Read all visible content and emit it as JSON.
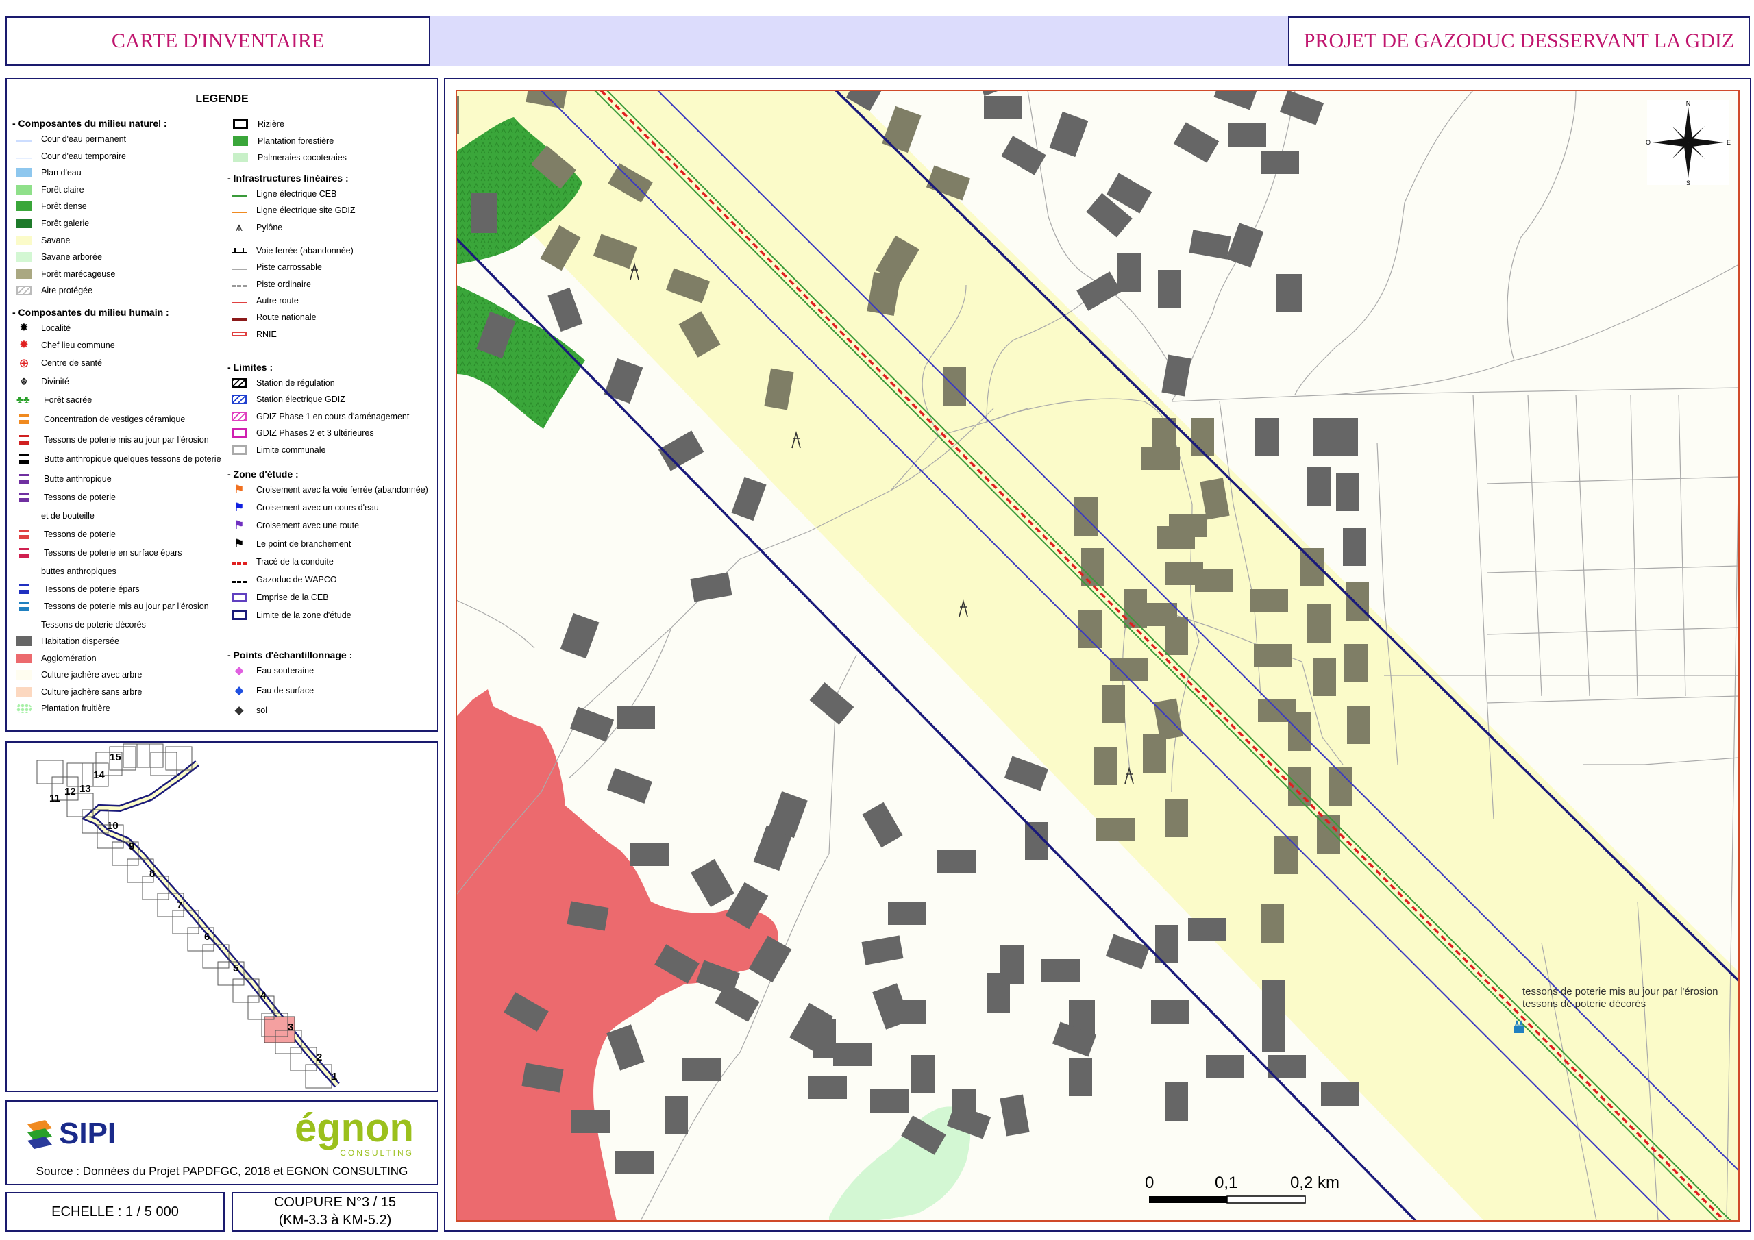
{
  "header": {
    "left_title": "CARTE D'INVENTAIRE",
    "right_title": "PROJET DE GAZODUC DESSERVANT LA GDIZ"
  },
  "legend": {
    "title": "LEGENDE",
    "sections": [
      {
        "title": "- Composantes du milieu naturel :",
        "items": [
          {
            "label": "Cour d'eau permanent",
            "swatch": "line",
            "color": "#ccddff"
          },
          {
            "label": "Cour d'eau temporaire",
            "swatch": "line",
            "color": "#e6efff"
          },
          {
            "label": "Plan d'eau",
            "swatch": "fill",
            "color": "#8ec7ee"
          },
          {
            "label": "Forêt claire",
            "swatch": "fill",
            "color": "#8fe08a"
          },
          {
            "label": "Forêt dense",
            "swatch": "fill",
            "color": "#3aa63a"
          },
          {
            "label": "Forêt galerie",
            "swatch": "fill",
            "color": "#1e7a2a"
          },
          {
            "label": "Savane",
            "swatch": "fill",
            "color": "#fbfbc9"
          },
          {
            "label": "Savane arborée",
            "swatch": "fill",
            "color": "#d3f7d3"
          },
          {
            "label": "Forêt marécageuse",
            "swatch": "fill",
            "color": "#aaa882"
          },
          {
            "label": "Aire protégée",
            "swatch": "hatch",
            "color": "#bbbbbb"
          }
        ]
      },
      {
        "title": "- Composantes du milieu humain :",
        "items": [
          {
            "label": "Localité",
            "swatch": "star",
            "color": "#000000"
          },
          {
            "label": "Chef lieu commune",
            "swatch": "star",
            "color": "#e02020"
          },
          {
            "label": "Centre de santé",
            "swatch": "cross",
            "color": "#e02020"
          },
          {
            "label": "Divinité",
            "swatch": "glyph",
            "color": "#000000"
          },
          {
            "label": "Forêt sacrée",
            "swatch": "tree",
            "color": "#2aa02a"
          },
          {
            "label": "Concentration de vestiges céramique",
            "swatch": "factory",
            "color": "#f08a20"
          },
          {
            "label": "Tessons de poterie mis au jour par l'érosion",
            "swatch": "factory",
            "color": "#d02020"
          },
          {
            "label": "Butte anthropique quelques tessons de poterie",
            "swatch": "factory",
            "color": "#000000"
          },
          {
            "label": "Butte anthropique",
            "swatch": "factory",
            "color": "#7030a0"
          },
          {
            "label": "Tessons de poterie",
            "swatch": "factory",
            "color": "#7030a0"
          },
          {
            "label": "et de bouteille",
            "swatch": "none",
            "color": ""
          },
          {
            "label": "Tessons de poterie",
            "swatch": "factory",
            "color": "#e04040"
          },
          {
            "label": "Tessons de poterie en surface épars",
            "swatch": "factory",
            "color": "#d02050"
          },
          {
            "label": "buttes anthropiques",
            "swatch": "none",
            "color": ""
          },
          {
            "label": "Tessons de poterie épars",
            "swatch": "factory",
            "color": "#2030c0"
          },
          {
            "label": "Tessons de poterie mis au jour par l'érosion",
            "swatch": "factory",
            "color": "#2080c0"
          },
          {
            "label": "Tessons de poterie décorés",
            "swatch": "none",
            "color": ""
          },
          {
            "label": "Habitation dispersée",
            "swatch": "fill",
            "color": "#666666"
          },
          {
            "label": "Agglomération",
            "swatch": "fill",
            "color": "#ec6a6e"
          },
          {
            "label": "Culture jachère avec arbre",
            "swatch": "fill",
            "color": "#fffdf0"
          },
          {
            "label": "Culture jachère sans arbre",
            "swatch": "fill",
            "color": "#fcd8c0"
          },
          {
            "label": "Plantation fruitière",
            "swatch": "dots",
            "color": "#a8f0a8"
          }
        ]
      },
      {
        "title": "",
        "items": [
          {
            "label": "Rizière",
            "swatch": "outline",
            "color": "#000000"
          },
          {
            "label": "Plantation forestière",
            "swatch": "fill",
            "color": "#3aa63a"
          },
          {
            "label": "Palmeraies cocoteraies",
            "swatch": "fill",
            "color": "#c8f0c8"
          }
        ]
      },
      {
        "title": "- Infrastructures linéaires  :",
        "items": [
          {
            "label": "Ligne électrique CEB",
            "swatch": "line",
            "color": "#3a9a3a"
          },
          {
            "label": "Ligne électrique site GDIZ",
            "swatch": "line",
            "color": "#f08a20"
          },
          {
            "label": "Pylône",
            "swatch": "pylon",
            "color": "#333333"
          },
          {
            "label": "Voie ferrée (abandonnée)",
            "swatch": "rail",
            "color": "#000000"
          },
          {
            "label": "Piste carrossable",
            "swatch": "line",
            "color": "#aaaaaa"
          },
          {
            "label": "Piste ordinaire",
            "swatch": "dash",
            "color": "#999999"
          },
          {
            "label": "Autre route",
            "swatch": "line",
            "color": "#e04040"
          },
          {
            "label": "Route nationale",
            "swatch": "thick",
            "color": "#8b1a1a"
          },
          {
            "label": "RNIE",
            "swatch": "double",
            "color": "#e04040"
          }
        ]
      },
      {
        "title": "- Limites :",
        "items": [
          {
            "label": "Station de régulation",
            "swatch": "hatch",
            "color": "#000000"
          },
          {
            "label": "Station électrique GDIZ",
            "swatch": "hatch",
            "color": "#2040d0"
          },
          {
            "label": "GDIZ Phase 1 en cours d'aménagement",
            "swatch": "hatch",
            "color": "#e040c0"
          },
          {
            "label": "GDIZ Phases 2 et 3 ultérieures",
            "swatch": "outline",
            "color": "#d020b0"
          },
          {
            "label": "Limite communale",
            "swatch": "outline",
            "color": "#aaaaaa"
          }
        ]
      },
      {
        "title": "- Zone d'étude :",
        "items": [
          {
            "label": "Croisement avec la voie ferrée (abandonnée)",
            "swatch": "flag",
            "color": "#f07020"
          },
          {
            "label": "Croisement avec un cours d'eau",
            "swatch": "flag",
            "color": "#1020e0"
          },
          {
            "label": "Croisement avec une route",
            "swatch": "flag",
            "color": "#7030c0"
          },
          {
            "label": "Le point de branchement",
            "swatch": "flag",
            "color": "#000000"
          },
          {
            "label": "Tracé de la conduite",
            "swatch": "dash",
            "color": "#e02020"
          },
          {
            "label": "Gazoduc de WAPCO",
            "swatch": "dash",
            "color": "#000000"
          },
          {
            "label": "Emprise de la CEB",
            "swatch": "outline",
            "color": "#6040c0"
          },
          {
            "label": "Limite de la zone d'étude",
            "swatch": "outline",
            "color": "#1a1a7a"
          }
        ]
      },
      {
        "title": "- Points d'échantillonnage :",
        "items": [
          {
            "label": "Eau souteraine",
            "swatch": "diamond",
            "color": "#e060e0"
          },
          {
            "label": "Eau de surface",
            "swatch": "diamond",
            "color": "#2050e0"
          },
          {
            "label": "sol",
            "swatch": "diamond",
            "color": "#333333"
          }
        ]
      }
    ]
  },
  "index_map": {
    "tiles": [
      "1",
      "2",
      "3",
      "4",
      "5",
      "6",
      "7",
      "8",
      "9",
      "10",
      "11",
      "12",
      "13",
      "14",
      "15"
    ],
    "current": "3"
  },
  "logos": {
    "left": "SIPI",
    "right": "égnon",
    "right_sub": "CONSULTING"
  },
  "source": "Source : Données du Projet PAPDFGC,  2018 et EGNON CONSULTING",
  "scale": {
    "label": "ECHELLE : 1 / 5 000"
  },
  "cut": {
    "line1": "COUPURE N°3 / 15",
    "line2": "(KM-3.3 à KM-5.2)"
  },
  "map": {
    "annotation_line1": "tessons de poterie mis au jour par l'érosion",
    "annotation_line2": "tessons de poterie décorés",
    "scalebar": [
      "0",
      "0,1",
      "0,2 km"
    ],
    "compass": [
      "N",
      "S",
      "E",
      "O"
    ],
    "colors": {
      "savane": "#fbfbc9",
      "agglo": "#ec6a6e",
      "forest": "#3aa63a",
      "house_dark": "#666666",
      "house_olive": "#7f7e66",
      "palm": "#d3f7d3",
      "boundary": "#1a1a7a",
      "ceb": "#3a9a3a",
      "pipeline": "#e02020"
    }
  }
}
